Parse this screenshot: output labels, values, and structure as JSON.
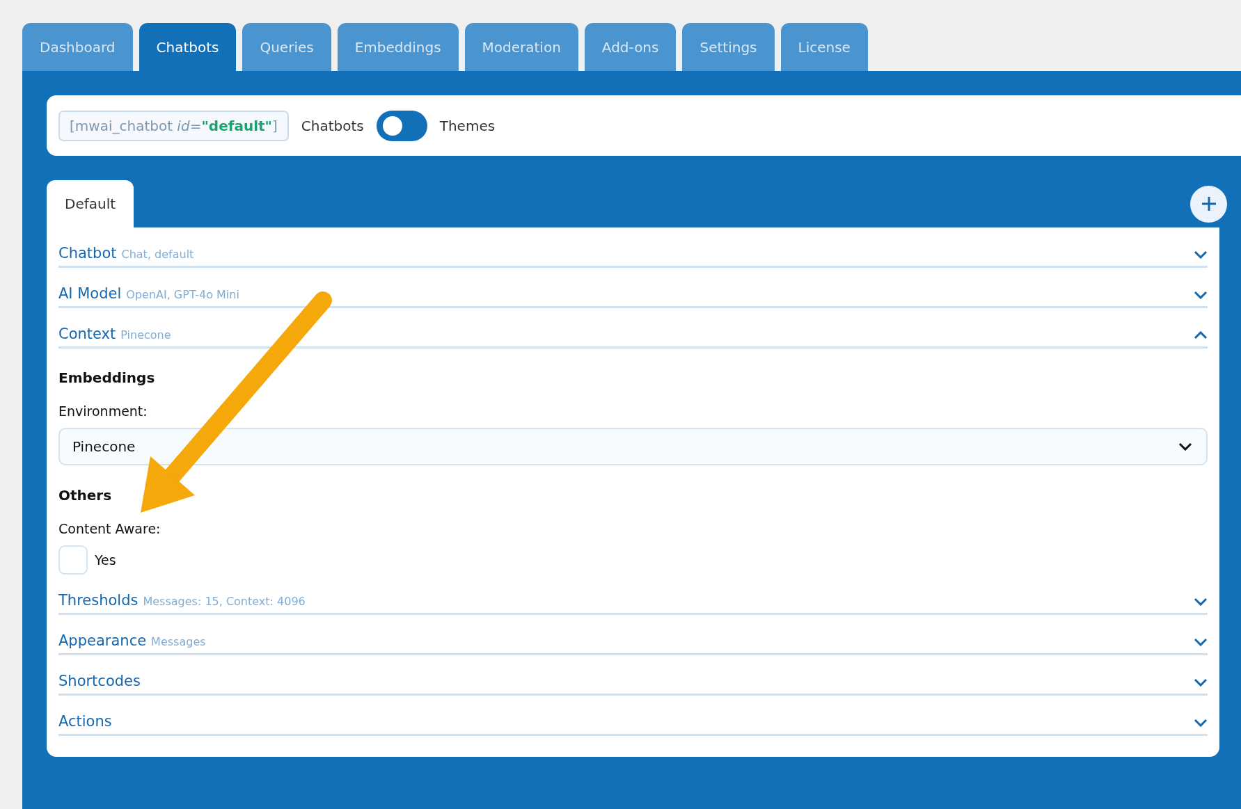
{
  "tabs": [
    {
      "label": "Dashboard",
      "selected": false
    },
    {
      "label": "Chatbots",
      "selected": true
    },
    {
      "label": "Queries",
      "selected": false
    },
    {
      "label": "Embeddings",
      "selected": false
    },
    {
      "label": "Moderation",
      "selected": false
    },
    {
      "label": "Add-ons",
      "selected": false
    },
    {
      "label": "Settings",
      "selected": false
    },
    {
      "label": "License",
      "selected": false
    }
  ],
  "shortcode": {
    "parts": [
      {
        "text": "[mwai_chatbot ",
        "kind": "plain"
      },
      {
        "text": "id",
        "kind": "attr"
      },
      {
        "text": "=",
        "kind": "plain"
      },
      {
        "text": "\"default\"",
        "kind": "value"
      },
      {
        "text": "]",
        "kind": "plain"
      }
    ]
  },
  "mode_switch": {
    "left_label": "Chatbots",
    "right_label": "Themes",
    "on": false
  },
  "chatbot_tabs": [
    {
      "label": "Default",
      "selected": true
    }
  ],
  "sections": [
    {
      "title": "Chatbot",
      "summary": "Chat, default",
      "expanded": false
    },
    {
      "title": "AI Model",
      "summary": "OpenAI, GPT-4o Mini",
      "expanded": false
    },
    {
      "title": "Context",
      "summary": "Pinecone",
      "expanded": true,
      "groups": [
        {
          "heading": "Embeddings",
          "fields": [
            {
              "kind": "select",
              "label": "Environment:",
              "value": "Pinecone"
            }
          ]
        },
        {
          "heading": "Others",
          "fields": [
            {
              "kind": "checkbox",
              "label": "Content Aware:",
              "option": "Yes",
              "checked": false
            }
          ]
        }
      ]
    },
    {
      "title": "Thresholds",
      "summary": "Messages: 15, Context: 4096",
      "expanded": false
    },
    {
      "title": "Appearance",
      "summary": "Messages",
      "expanded": false
    },
    {
      "title": "Shortcodes",
      "expanded": false
    },
    {
      "title": "Actions",
      "expanded": false
    }
  ]
}
